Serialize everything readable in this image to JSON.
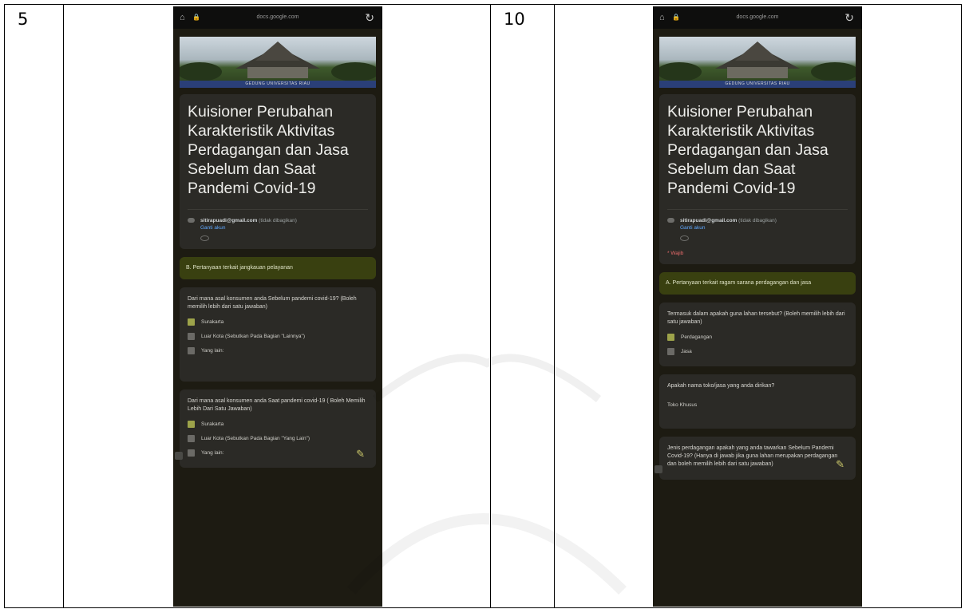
{
  "rows": [
    {
      "number": "5",
      "status": {
        "url": "docs.google.com"
      },
      "banner_caption": "GEDUNG UNIVERSITAS RIAU",
      "form_title": "Kuisioner Perubahan Karakteristik Aktivitas Perdagangan dan Jasa Sebelum dan Saat Pandemi Covid-19",
      "account": {
        "email": "sitirapuadi@gmail.com",
        "suffix": "(tidak dibagikan)",
        "switch": "Ganti akun"
      },
      "section": "B. Pertanyaan terkait jangkauan pelayanan",
      "q1": {
        "text": "Dari mana asal konsumen anda Sebelum pandemi covid-19? (Boleh memilih lebih dari satu jawaban)",
        "options": [
          "Surakarta",
          "Luar Kota (Sebutkan Pada Bagian \"Lainnya\")",
          "Yang lain:"
        ]
      },
      "q2": {
        "text": "Dari mana asal konsumen anda Saat pandemi covid-19 ( Boleh Memilih Lebih Dari Satu Jawaban)",
        "options": [
          "Surakarta",
          "Luar Kota (Sebutkan Pada Bagian \"Yang Lain\")",
          "Yang lain:"
        ]
      }
    },
    {
      "number": "10",
      "status": {
        "url": "docs.google.com"
      },
      "banner_caption": "GEDUNG UNIVERSITAS RIAU",
      "form_title": "Kuisioner Perubahan Karakteristik Aktivitas Perdagangan dan Jasa Sebelum dan Saat Pandemi Covid-19",
      "account": {
        "email": "sitirapuadi@gmail.com",
        "suffix": "(tidak dibagikan)",
        "switch": "Ganti akun"
      },
      "required": "* Wajib",
      "section": "A. Pertanyaan terkait ragam sarana perdagangan dan jasa",
      "q1": {
        "text": "Termasuk dalam apakah guna lahan tersebut? (Boleh memilih lebih dari satu jawaban)",
        "options": [
          "Perdagangan",
          "Jasa"
        ]
      },
      "q2": {
        "text": "Apakah nama toko/jasa yang anda dirikan?",
        "answer": "Toko Khusus"
      },
      "q3": {
        "text": "Jenis perdagangan apakah yang anda tawarkan Sebelum Pandemi Covid-19? (Hanya di jawab jika guna lahan merupakan perdagangan dan boleh memilih lebih dari satu jawaban)"
      }
    }
  ]
}
